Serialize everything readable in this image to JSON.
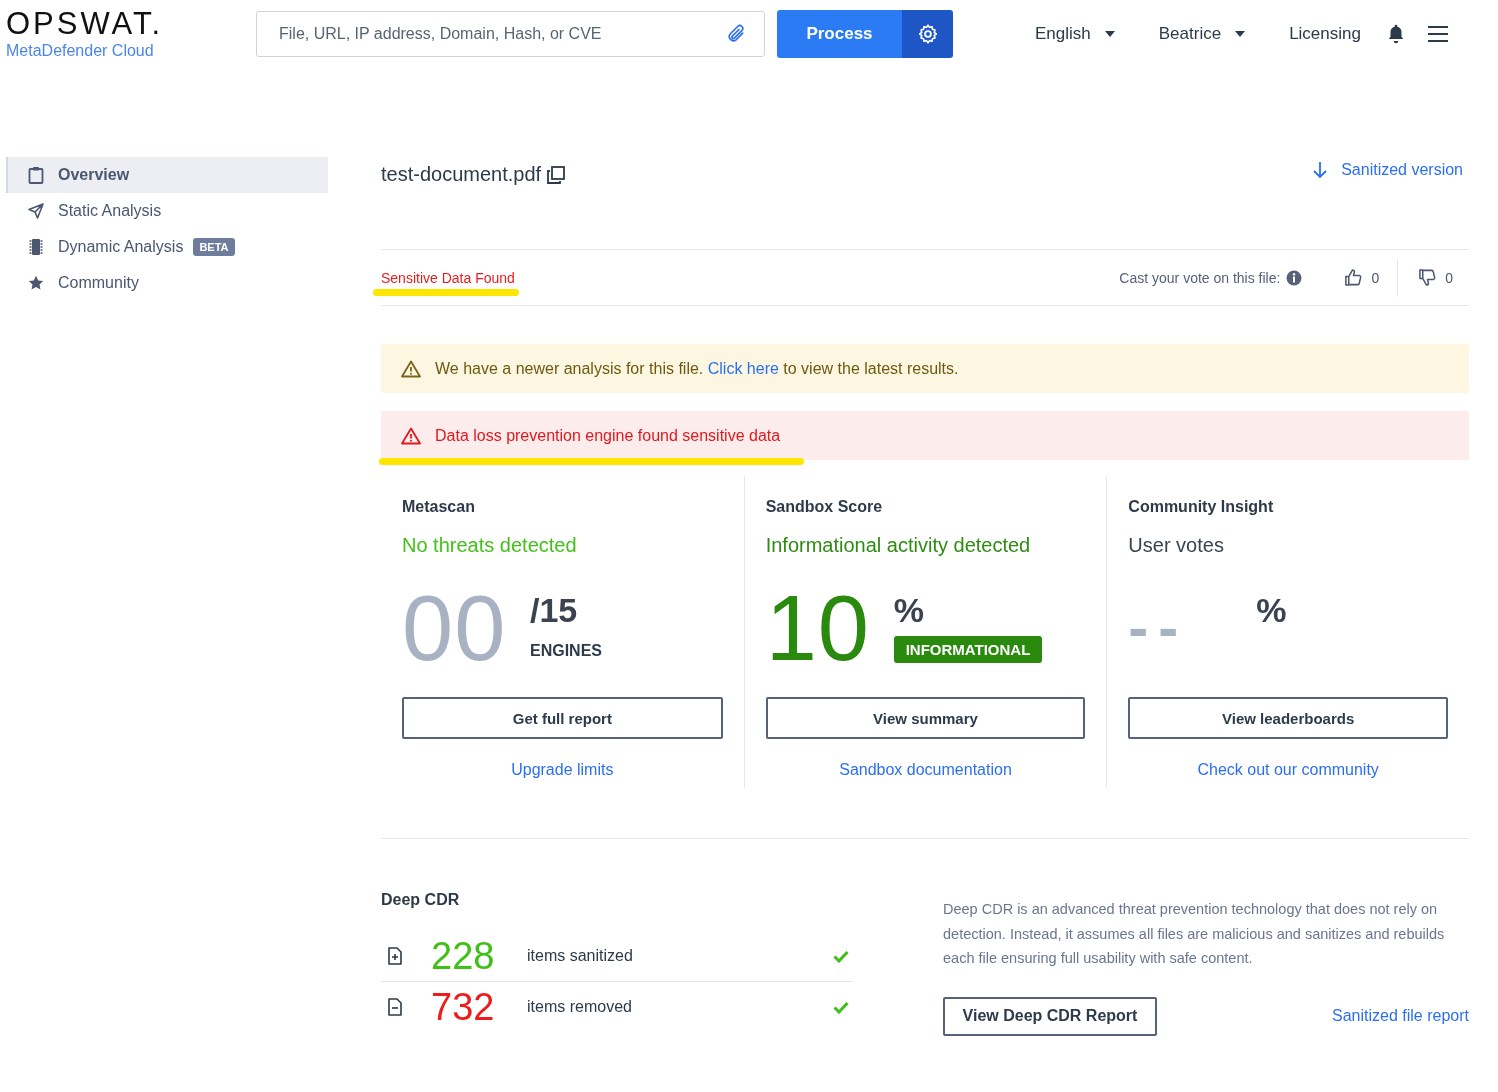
{
  "header": {
    "logo": "OPSWAT.",
    "product": "MetaDefender Cloud",
    "search": {
      "placeholder": "File, URL, IP address, Domain, Hash, or CVE"
    },
    "process_button": "Process",
    "language": "English",
    "user": "Beatrice",
    "licensing": "Licensing"
  },
  "sidebar": {
    "items": [
      {
        "label": "Overview",
        "selected": true
      },
      {
        "label": "Static Analysis",
        "selected": false
      },
      {
        "label": "Dynamic Analysis",
        "badge": "BETA",
        "selected": false
      },
      {
        "label": "Community",
        "selected": false
      }
    ]
  },
  "file": {
    "name": "test-document.pdf",
    "sanitized_link": "Sanitized version"
  },
  "status": {
    "tag": "Sensitive Data Found",
    "highlighted": true
  },
  "vote": {
    "prompt": "Cast your vote on this file:",
    "up": "0",
    "down": "0"
  },
  "alerts": [
    {
      "kind": "warning",
      "text": "We have a newer analysis for this file. ",
      "link": "Click here",
      "after": " to view the latest results.",
      "highlighted": false
    },
    {
      "kind": "danger",
      "text": "Data loss prevention engine found sensitive data",
      "highlighted": true
    }
  ],
  "cards": [
    {
      "kind": "metascan",
      "title": "Metascan",
      "verdict": "No threats detected",
      "score": "00",
      "total": "/15",
      "unit": "ENGINES",
      "button": "Get full report",
      "link": "Upgrade limits"
    },
    {
      "kind": "sandbox",
      "title": "Sandbox Score",
      "verdict": "Informational activity detected",
      "score": "10",
      "total": "%",
      "badge": "INFORMATIONAL",
      "button": "View summary",
      "link": "Sandbox documentation"
    },
    {
      "kind": "community",
      "title": "Community Insight",
      "verdict": "User votes",
      "score": "--",
      "total": "%",
      "button": "View leaderboards",
      "link": "Check out our community"
    }
  ],
  "deep_cdr": {
    "title": "Deep CDR",
    "rows": [
      {
        "kind": "sanitized",
        "count": "228",
        "label": "items sanitized",
        "done": true
      },
      {
        "kind": "removed",
        "count": "732",
        "label": "items removed",
        "done": true
      }
    ],
    "description": "Deep CDR is an advanced threat prevention technology that does not rely on detection. Instead, it assumes all files are malicious and sanitizes and rebuilds each file ensuring full usability with safe content.",
    "button": "View Deep CDR Report",
    "link": "Sanitized file report"
  }
}
